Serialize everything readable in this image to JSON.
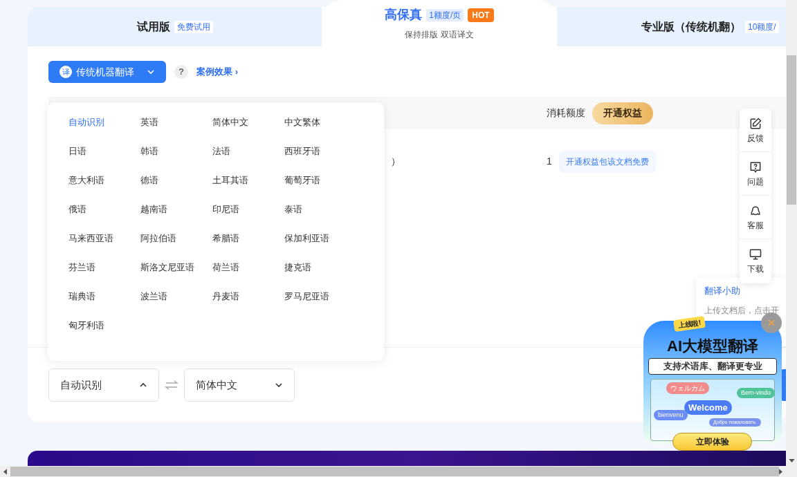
{
  "tabs": [
    {
      "title": "试用版",
      "badge": "免费试用",
      "selected": false
    },
    {
      "title": "高保真",
      "badge": "1额度/页",
      "hot": "HOT",
      "subtitle": "保持排版 双语译文",
      "selected": true
    },
    {
      "title": "专业版（传统机翻）",
      "badge": "10额度/",
      "selected": false
    }
  ],
  "engine_button": {
    "icon_char": "译",
    "label": "传统机器翻译"
  },
  "help": "?",
  "examples_link": "案例效果",
  "examples_link_arrow": "›",
  "table": {
    "header": {
      "quota": "消耗额度",
      "upgrade_button": "开通权益"
    },
    "rows": [
      {
        "name": "）",
        "quota": "1",
        "note": "开通权益包该文档免费"
      }
    ]
  },
  "language_menu": [
    {
      "label": "自动识别",
      "selected": true
    },
    {
      "label": "英语",
      "selected": false
    },
    {
      "label": "简体中文",
      "selected": false
    },
    {
      "label": "中文繁体",
      "selected": false
    },
    {
      "label": "日语",
      "selected": false
    },
    {
      "label": "韩语",
      "selected": false
    },
    {
      "label": "法语",
      "selected": false
    },
    {
      "label": "西班牙语",
      "selected": false
    },
    {
      "label": "意大利语",
      "selected": false
    },
    {
      "label": "德语",
      "selected": false
    },
    {
      "label": "土耳其语",
      "selected": false
    },
    {
      "label": "葡萄牙语",
      "selected": false
    },
    {
      "label": "俄语",
      "selected": false
    },
    {
      "label": "越南语",
      "selected": false
    },
    {
      "label": "印尼语",
      "selected": false
    },
    {
      "label": "泰语",
      "selected": false
    },
    {
      "label": "马来西亚语",
      "selected": false
    },
    {
      "label": "阿拉伯语",
      "selected": false
    },
    {
      "label": "希腊语",
      "selected": false
    },
    {
      "label": "保加利亚语",
      "selected": false
    },
    {
      "label": "芬兰语",
      "selected": false
    },
    {
      "label": "斯洛文尼亚语",
      "selected": false
    },
    {
      "label": "荷兰语",
      "selected": false
    },
    {
      "label": "捷克语",
      "selected": false
    },
    {
      "label": "瑞典语",
      "selected": false
    },
    {
      "label": "波兰语",
      "selected": false
    },
    {
      "label": "丹麦语",
      "selected": false
    },
    {
      "label": "罗马尼亚语",
      "selected": false
    },
    {
      "label": "匈牙利语",
      "selected": false
    }
  ],
  "source_language": {
    "value": "自动识别",
    "expanded": true
  },
  "target_language": {
    "value": "简体中文",
    "expanded": false
  },
  "side_toolbar": [
    {
      "kind": "feedback",
      "label": "反馈"
    },
    {
      "kind": "question",
      "label": "问题"
    },
    {
      "kind": "service",
      "label": "客服"
    },
    {
      "kind": "download",
      "label": "下载"
    }
  ],
  "assistant_tip": {
    "title": "翻译小助",
    "text": "上传文档后，点击开"
  },
  "promo_popup": {
    "badge": "上线啦!",
    "title": "AI大模型翻译",
    "subtitle": "支持术语库、翻译更专业",
    "bubbles": [
      {
        "text": "ウェルカム",
        "color": "#f28b8b"
      },
      {
        "text": "Bem-vindo",
        "color": "#4fc39a"
      },
      {
        "text": "Welcome",
        "color": "#4b7bf5"
      },
      {
        "text": "bienvenu",
        "color": "#6b8df5"
      },
      {
        "text": "Добро пожаловать.",
        "color": "#7b93f0"
      }
    ],
    "button": "立即体验"
  }
}
